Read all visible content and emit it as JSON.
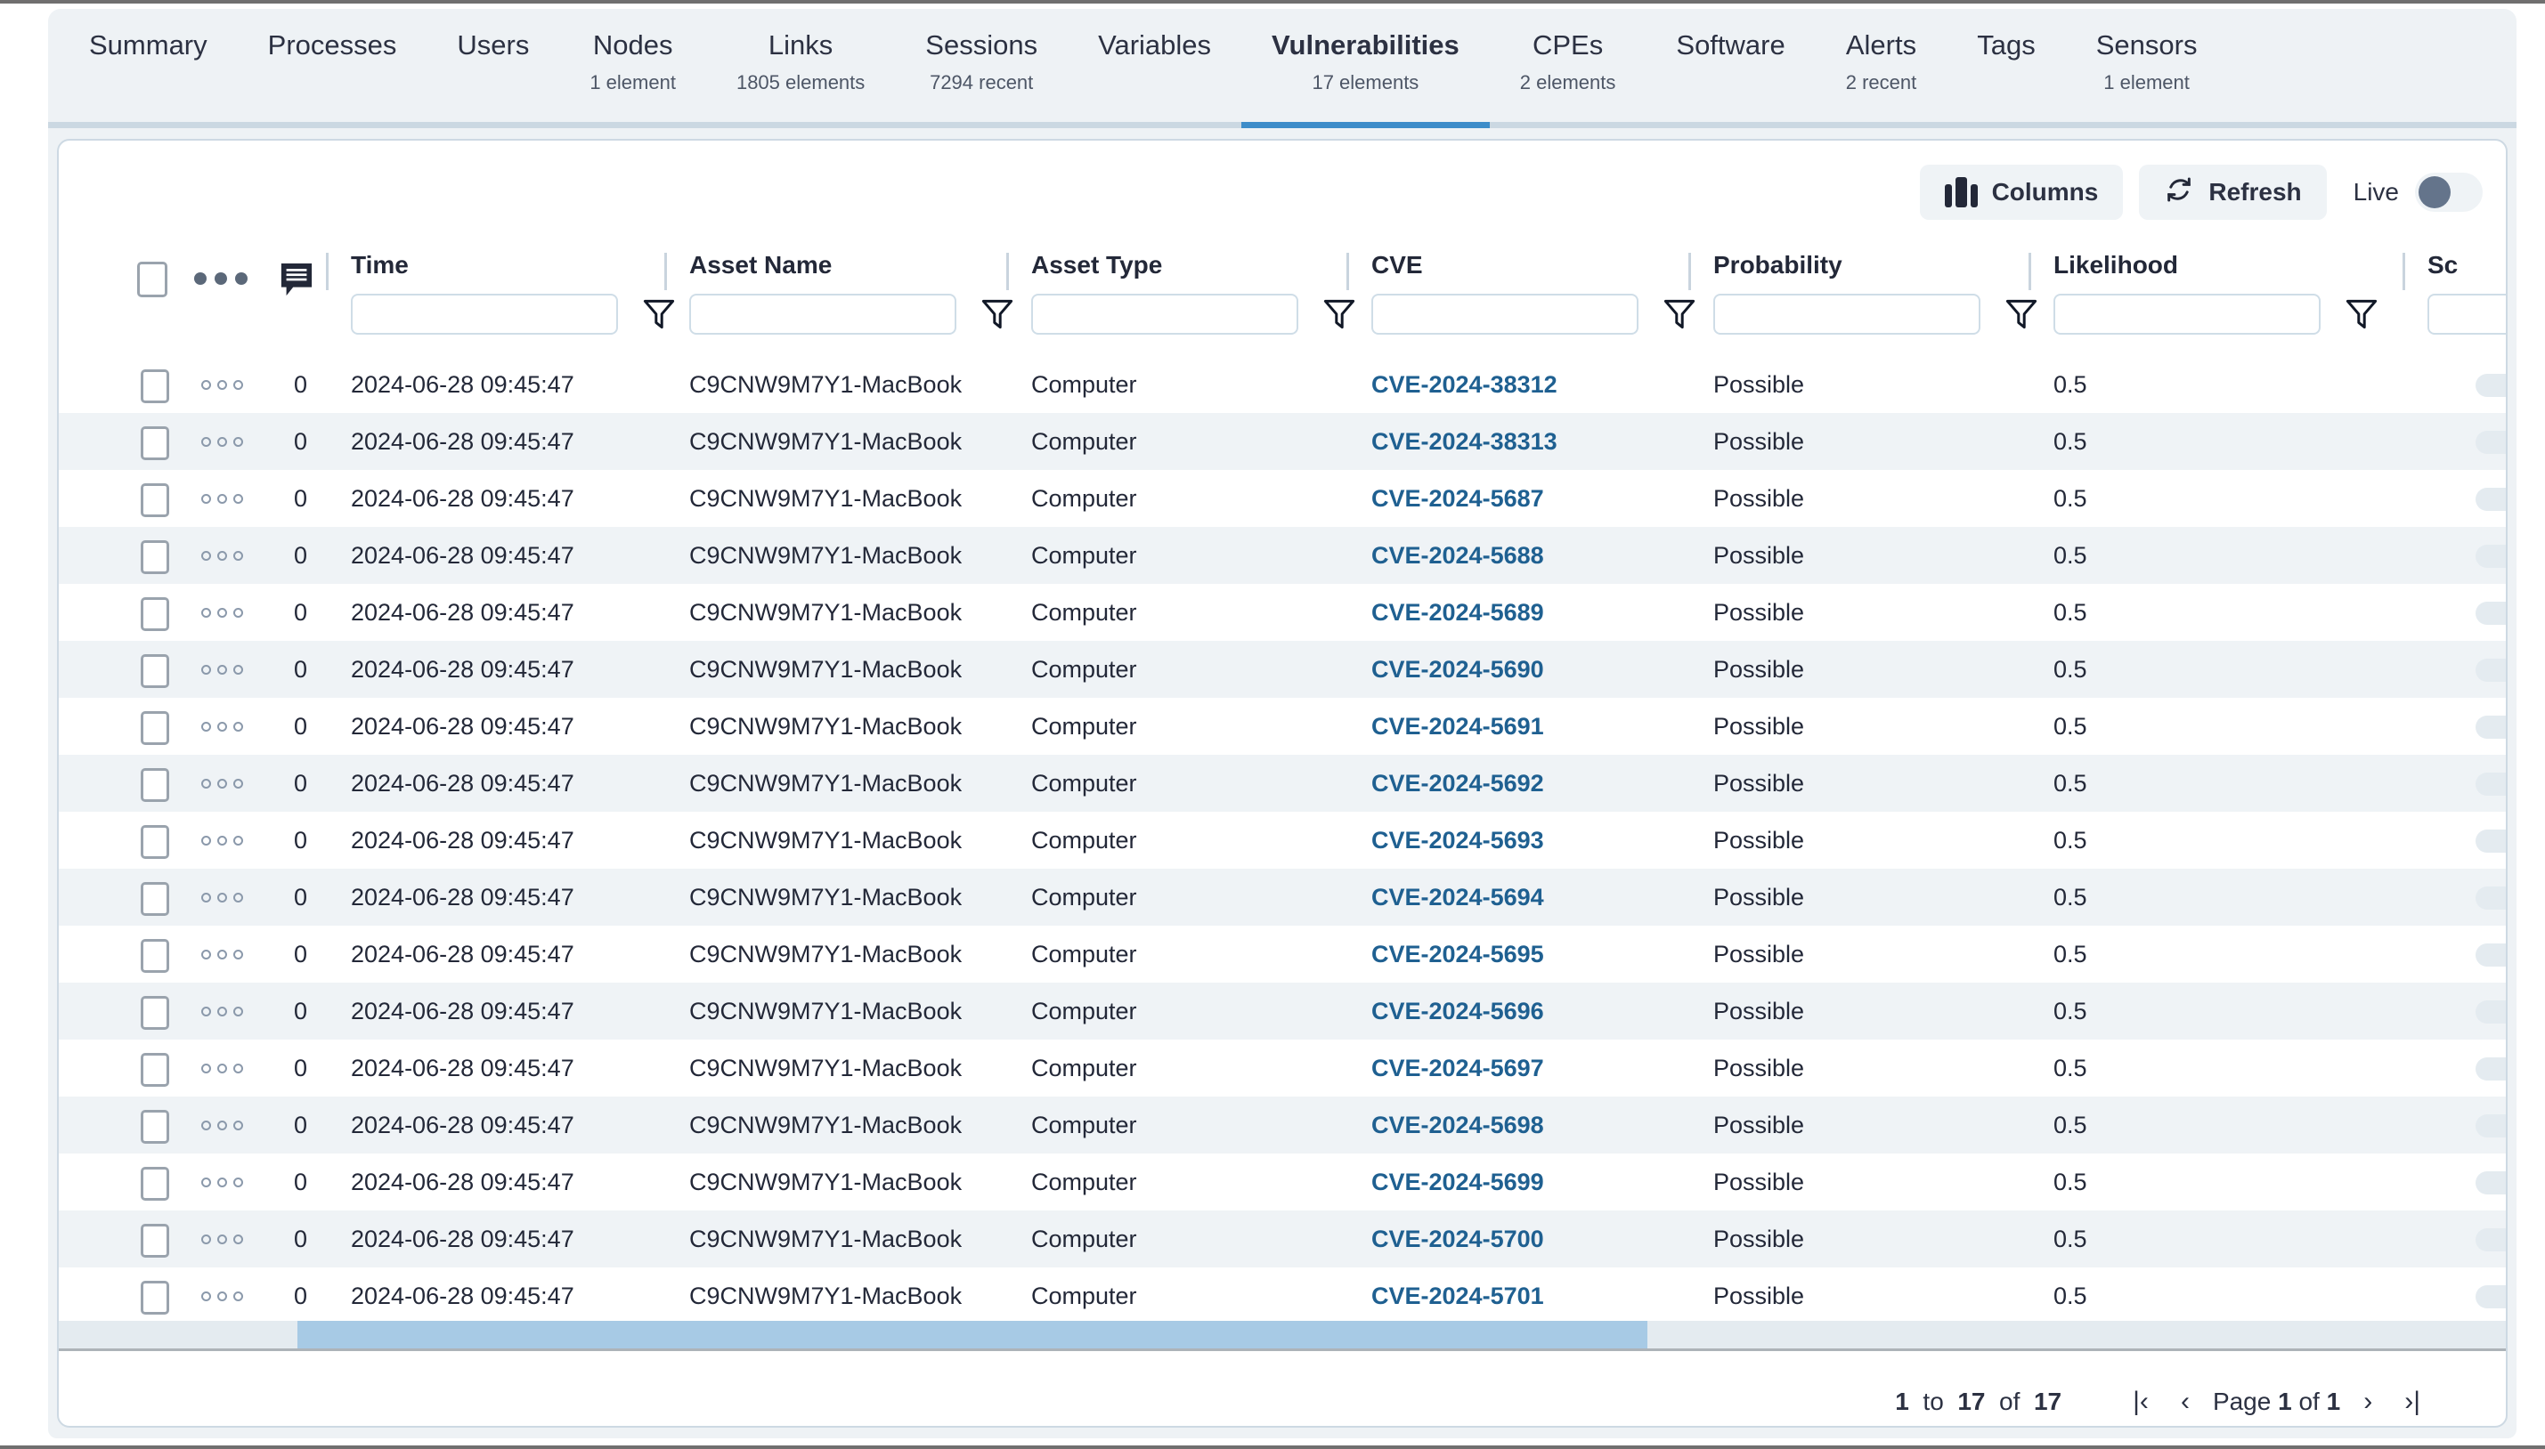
{
  "tabs": [
    {
      "label": "Summary",
      "count": "",
      "active": false
    },
    {
      "label": "Processes",
      "count": "",
      "active": false
    },
    {
      "label": "Users",
      "count": "",
      "active": false
    },
    {
      "label": "Nodes",
      "count": "1 element",
      "active": false
    },
    {
      "label": "Links",
      "count": "1805 elements",
      "active": false
    },
    {
      "label": "Sessions",
      "count": "7294 recent",
      "active": false
    },
    {
      "label": "Variables",
      "count": "",
      "active": false
    },
    {
      "label": "Vulnerabilities",
      "count": "17 elements",
      "active": true
    },
    {
      "label": "CPEs",
      "count": "2 elements",
      "active": false
    },
    {
      "label": "Software",
      "count": "",
      "active": false
    },
    {
      "label": "Alerts",
      "count": "2 recent",
      "active": false
    },
    {
      "label": "Tags",
      "count": "",
      "active": false
    },
    {
      "label": "Sensors",
      "count": "1 element",
      "active": false
    }
  ],
  "toolbar": {
    "columns_label": "Columns",
    "refresh_label": "Refresh",
    "live_label": "Live",
    "live_on": false
  },
  "table": {
    "columns": [
      {
        "key": "time",
        "label": "Time",
        "filter_value": "",
        "filter_placeholder": ""
      },
      {
        "key": "asset_name",
        "label": "Asset Name",
        "filter_value": "",
        "filter_placeholder": ""
      },
      {
        "key": "asset_type",
        "label": "Asset Type",
        "filter_value": "",
        "filter_placeholder": ""
      },
      {
        "key": "cve",
        "label": "CVE",
        "filter_value": "",
        "filter_placeholder": ""
      },
      {
        "key": "probability",
        "label": "Probability",
        "filter_value": "",
        "filter_placeholder": ""
      },
      {
        "key": "likelihood",
        "label": "Likelihood",
        "filter_value": "",
        "filter_placeholder": ""
      },
      {
        "key": "score",
        "label": "Sc",
        "filter_value": "",
        "filter_placeholder": ""
      }
    ],
    "rows": [
      {
        "count": "0",
        "time": "2024-06-28 09:45:47",
        "asset_name": "C9CNW9M7Y1-MacBook",
        "asset_type": "Computer",
        "cve": "CVE-2024-38312",
        "probability": "Possible",
        "likelihood": "0.5"
      },
      {
        "count": "0",
        "time": "2024-06-28 09:45:47",
        "asset_name": "C9CNW9M7Y1-MacBook",
        "asset_type": "Computer",
        "cve": "CVE-2024-38313",
        "probability": "Possible",
        "likelihood": "0.5"
      },
      {
        "count": "0",
        "time": "2024-06-28 09:45:47",
        "asset_name": "C9CNW9M7Y1-MacBook",
        "asset_type": "Computer",
        "cve": "CVE-2024-5687",
        "probability": "Possible",
        "likelihood": "0.5"
      },
      {
        "count": "0",
        "time": "2024-06-28 09:45:47",
        "asset_name": "C9CNW9M7Y1-MacBook",
        "asset_type": "Computer",
        "cve": "CVE-2024-5688",
        "probability": "Possible",
        "likelihood": "0.5"
      },
      {
        "count": "0",
        "time": "2024-06-28 09:45:47",
        "asset_name": "C9CNW9M7Y1-MacBook",
        "asset_type": "Computer",
        "cve": "CVE-2024-5689",
        "probability": "Possible",
        "likelihood": "0.5"
      },
      {
        "count": "0",
        "time": "2024-06-28 09:45:47",
        "asset_name": "C9CNW9M7Y1-MacBook",
        "asset_type": "Computer",
        "cve": "CVE-2024-5690",
        "probability": "Possible",
        "likelihood": "0.5"
      },
      {
        "count": "0",
        "time": "2024-06-28 09:45:47",
        "asset_name": "C9CNW9M7Y1-MacBook",
        "asset_type": "Computer",
        "cve": "CVE-2024-5691",
        "probability": "Possible",
        "likelihood": "0.5"
      },
      {
        "count": "0",
        "time": "2024-06-28 09:45:47",
        "asset_name": "C9CNW9M7Y1-MacBook",
        "asset_type": "Computer",
        "cve": "CVE-2024-5692",
        "probability": "Possible",
        "likelihood": "0.5"
      },
      {
        "count": "0",
        "time": "2024-06-28 09:45:47",
        "asset_name": "C9CNW9M7Y1-MacBook",
        "asset_type": "Computer",
        "cve": "CVE-2024-5693",
        "probability": "Possible",
        "likelihood": "0.5"
      },
      {
        "count": "0",
        "time": "2024-06-28 09:45:47",
        "asset_name": "C9CNW9M7Y1-MacBook",
        "asset_type": "Computer",
        "cve": "CVE-2024-5694",
        "probability": "Possible",
        "likelihood": "0.5"
      },
      {
        "count": "0",
        "time": "2024-06-28 09:45:47",
        "asset_name": "C9CNW9M7Y1-MacBook",
        "asset_type": "Computer",
        "cve": "CVE-2024-5695",
        "probability": "Possible",
        "likelihood": "0.5"
      },
      {
        "count": "0",
        "time": "2024-06-28 09:45:47",
        "asset_name": "C9CNW9M7Y1-MacBook",
        "asset_type": "Computer",
        "cve": "CVE-2024-5696",
        "probability": "Possible",
        "likelihood": "0.5"
      },
      {
        "count": "0",
        "time": "2024-06-28 09:45:47",
        "asset_name": "C9CNW9M7Y1-MacBook",
        "asset_type": "Computer",
        "cve": "CVE-2024-5697",
        "probability": "Possible",
        "likelihood": "0.5"
      },
      {
        "count": "0",
        "time": "2024-06-28 09:45:47",
        "asset_name": "C9CNW9M7Y1-MacBook",
        "asset_type": "Computer",
        "cve": "CVE-2024-5698",
        "probability": "Possible",
        "likelihood": "0.5"
      },
      {
        "count": "0",
        "time": "2024-06-28 09:45:47",
        "asset_name": "C9CNW9M7Y1-MacBook",
        "asset_type": "Computer",
        "cve": "CVE-2024-5699",
        "probability": "Possible",
        "likelihood": "0.5"
      },
      {
        "count": "0",
        "time": "2024-06-28 09:45:47",
        "asset_name": "C9CNW9M7Y1-MacBook",
        "asset_type": "Computer",
        "cve": "CVE-2024-5700",
        "probability": "Possible",
        "likelihood": "0.5"
      },
      {
        "count": "0",
        "time": "2024-06-28 09:45:47",
        "asset_name": "C9CNW9M7Y1-MacBook",
        "asset_type": "Computer",
        "cve": "CVE-2024-5701",
        "probability": "Possible",
        "likelihood": "0.5"
      }
    ]
  },
  "pagination": {
    "range": "1 to 17 of 17",
    "range_from": "1",
    "range_to": "17",
    "range_total": "17",
    "page_prefix": "Page",
    "page_current": "1",
    "page_of": "of",
    "page_total": "1",
    "first_label": "|‹",
    "prev_label": "‹",
    "next_label": "›",
    "last_label": "›|"
  },
  "colors": {
    "accent": "#3d8dc9",
    "link": "#1f6091",
    "panel_bg": "#eef2f5",
    "row_alt": "#eff3f6",
    "scrollbar_thumb": "#a7cae5"
  }
}
